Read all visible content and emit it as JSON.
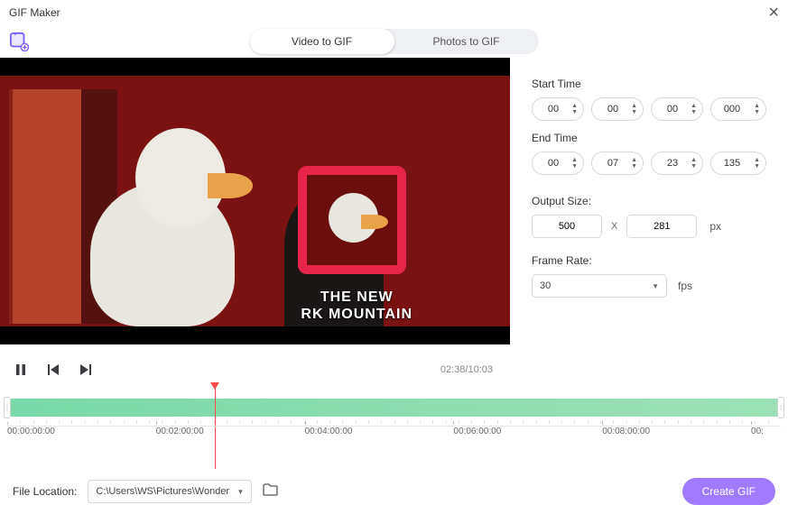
{
  "title": "GIF Maker",
  "tabs": {
    "video": "Video to GIF",
    "photos": "Photos to GIF",
    "active": "video"
  },
  "start_label": "Start Time",
  "end_label": "End Time",
  "start": {
    "h": "00",
    "m": "00",
    "s": "00",
    "ms": "000"
  },
  "end": {
    "h": "00",
    "m": "07",
    "s": "23",
    "ms": "135"
  },
  "output_label": "Output Size:",
  "output": {
    "w": "500",
    "h": "281",
    "unit": "px",
    "x": "X"
  },
  "frame_label": "Frame Rate:",
  "frame_rate": "30",
  "fps_unit": "fps",
  "playback": {
    "current": "02:38",
    "total": "10:03",
    "sep": "/"
  },
  "ruler": [
    "00:00:00:00",
    "00:02:00:00",
    "00:04:00:00",
    "00:06:00:00",
    "00:08:00:00",
    "00:"
  ],
  "footer": {
    "label": "File Location:",
    "path": "C:\\Users\\WS\\Pictures\\Wonder",
    "create": "Create GIF"
  },
  "scene_text": {
    "l1": "THE NEW",
    "l2": "RK MOUNTAIN"
  }
}
